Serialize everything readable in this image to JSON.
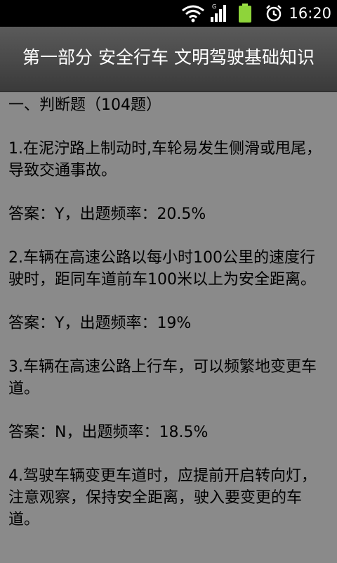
{
  "status_bar": {
    "time": "16:20",
    "icons": [
      "wifi-icon",
      "signal-icon",
      "battery-icon",
      "alarm-icon"
    ]
  },
  "title_bar": {
    "title": "第一部分  安全行车 文明驾驶基础知识"
  },
  "content": {
    "heading": "一、判断题（104题）",
    "items": [
      {
        "question": "1.在泥泞路上制动时,车轮易发生侧滑或甩尾，导致交通事故。",
        "answer": "答案：Y，出题频率：20.5%"
      },
      {
        "question": "2.车辆在高速公路以每小时100公里的速度行驶时，距同车道前车100米以上为安全距离。",
        "answer": "答案：Y，出题频率：19%"
      },
      {
        "question": "3.车辆在高速公路上行车，可以频繁地变更车道。",
        "answer": "答案：N，出题频率：18.5%"
      },
      {
        "question": "4.驾驶车辆变更车道时，应提前开启转向灯，注意观察，保持安全距离，驶入要变更的车道。",
        "answer": ""
      }
    ]
  },
  "colors": {
    "content_bg": "#8a8a8a",
    "titlebar_bg": "#4a4a4a",
    "battery": "#8ed43a"
  }
}
